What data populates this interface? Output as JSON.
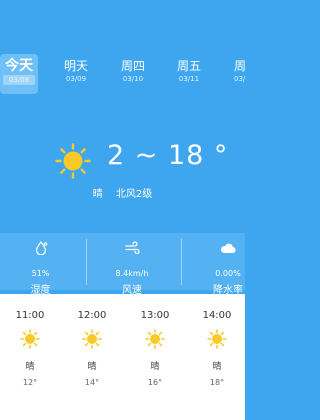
{
  "days": [
    {
      "day": "今天",
      "date": "03/08"
    },
    {
      "day": "明天",
      "date": "03/09"
    },
    {
      "day": "周四",
      "date": "03/10"
    },
    {
      "day": "周五",
      "date": "03/11"
    },
    {
      "day": "周",
      "date": "03/"
    }
  ],
  "current": {
    "temp": "2 ~ 18 °",
    "condition": "晴",
    "wind": "北风2级",
    "icon": "sun-icon"
  },
  "stats": [
    {
      "value": "51%",
      "label": "湿度",
      "icon": "humidity-drop-icon"
    },
    {
      "value": "8.4km/h",
      "label": "风速",
      "icon": "wind-icon"
    },
    {
      "value": "0.00%",
      "label": "降水率",
      "icon": "cloud-icon"
    }
  ],
  "hourly": [
    {
      "time": "11:00",
      "cond": "晴",
      "temp": "12°"
    },
    {
      "time": "12:00",
      "cond": "晴",
      "temp": "14°"
    },
    {
      "time": "13:00",
      "cond": "晴",
      "temp": "16°"
    },
    {
      "time": "14:00",
      "cond": "晴",
      "temp": "18°"
    }
  ],
  "colors": {
    "background": "#3ea6ef",
    "sun": "#f8c927",
    "panel": "#55b2f2"
  }
}
